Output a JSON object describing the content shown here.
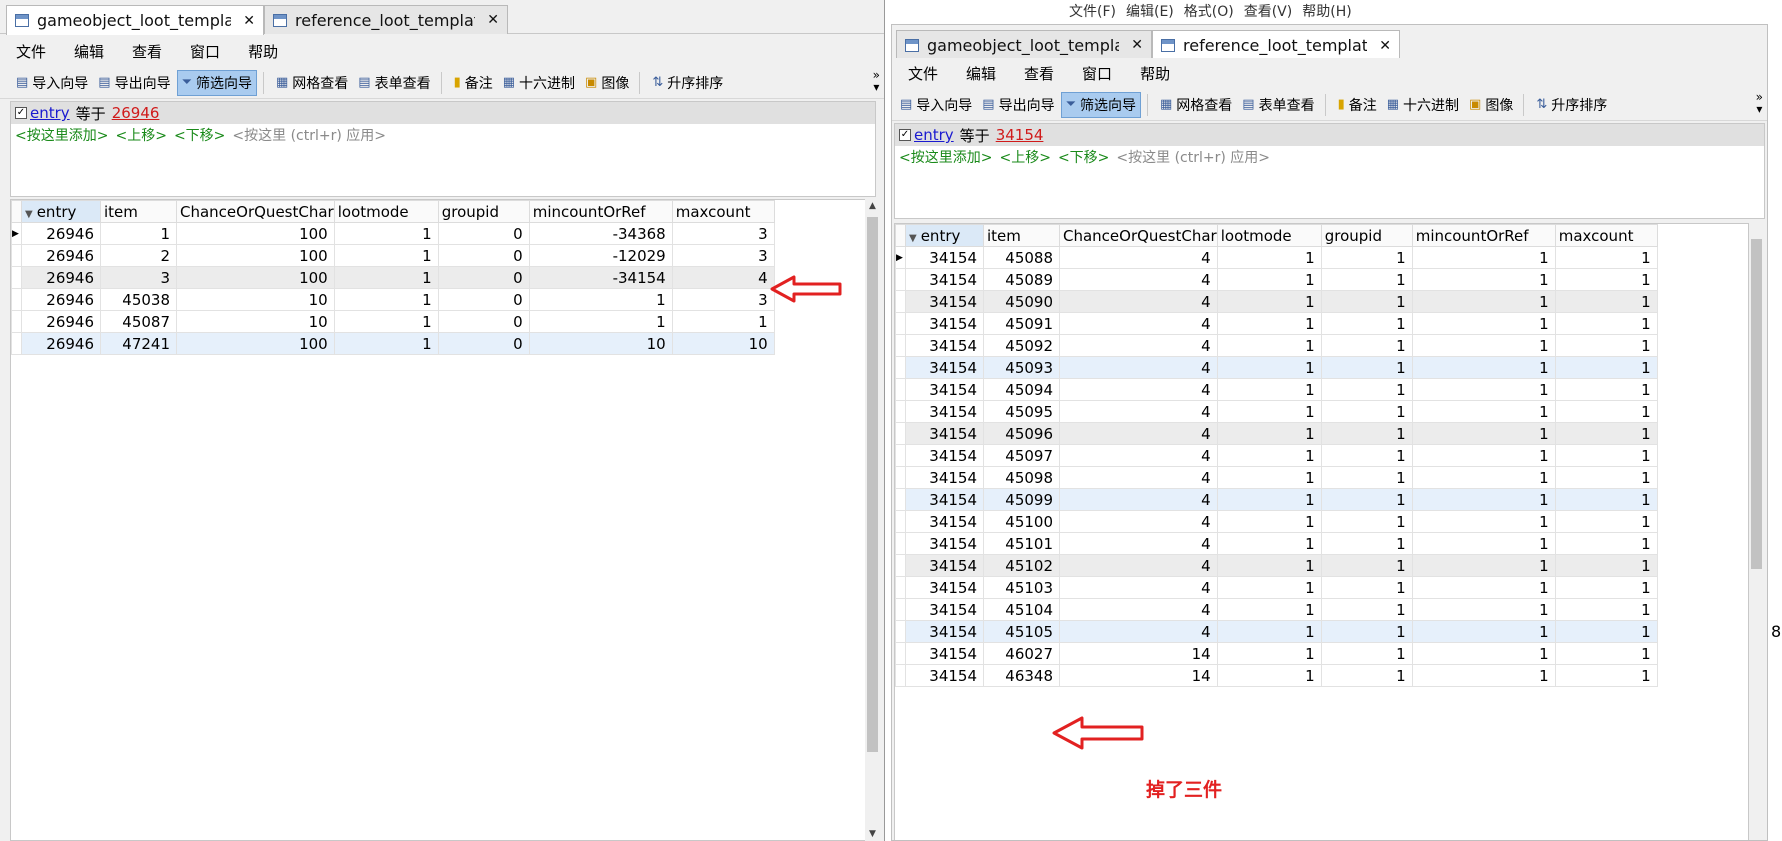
{
  "left": {
    "tabs": [
      {
        "label": "gameobject_loot_templa...",
        "active": true
      },
      {
        "label": "reference_loot_template...",
        "active": false
      }
    ],
    "menu": [
      "文件",
      "编辑",
      "查看",
      "窗口",
      "帮助"
    ],
    "toolbar": {
      "import": "导入向导",
      "export": "导出向导",
      "filter": "筛选向导",
      "grid_view": "网格查看",
      "form_view": "表单查看",
      "memo": "备注",
      "hex": "十六进制",
      "image": "图像",
      "sort_asc": "升序排序",
      "more": "»"
    },
    "filter": {
      "field": "entry",
      "op": "等于",
      "value": "26946",
      "add": "<按这里添加>",
      "up": "<上移>",
      "down": "<下移>",
      "apply": "<按这里 (ctrl+r) 应用>"
    },
    "columns": [
      "entry",
      "item",
      "ChanceOrQuestChar",
      "lootmode",
      "groupid",
      "mincountOrRef",
      "maxcount"
    ],
    "rows": [
      [
        "26946",
        "1",
        "100",
        "1",
        "0",
        "-34368",
        "3"
      ],
      [
        "26946",
        "2",
        "100",
        "1",
        "0",
        "-12029",
        "3"
      ],
      [
        "26946",
        "3",
        "100",
        "1",
        "0",
        "-34154",
        "4"
      ],
      [
        "26946",
        "45038",
        "10",
        "1",
        "0",
        "1",
        "3"
      ],
      [
        "26946",
        "45087",
        "10",
        "1",
        "0",
        "1",
        "1"
      ],
      [
        "26946",
        "47241",
        "100",
        "1",
        "0",
        "10",
        "10"
      ]
    ]
  },
  "right": {
    "background_menu": [
      "文件(F)",
      "编辑(E)",
      "格式(O)",
      "查看(V)",
      "帮助(H)"
    ],
    "tabs": [
      {
        "label": "gameobject_loot_templa...",
        "active": false
      },
      {
        "label": "reference_loot_template...",
        "active": true
      }
    ],
    "menu": [
      "文件",
      "编辑",
      "查看",
      "窗口",
      "帮助"
    ],
    "toolbar": {
      "import": "导入向导",
      "export": "导出向导",
      "filter": "筛选向导",
      "grid_view": "网格查看",
      "form_view": "表单查看",
      "memo": "备注",
      "hex": "十六进制",
      "image": "图像",
      "sort_asc": "升序排序",
      "more": "»"
    },
    "filter": {
      "field": "entry",
      "op": "等于",
      "value": "34154",
      "add": "<按这里添加>",
      "up": "<上移>",
      "down": "<下移>",
      "apply": "<按这里 (ctrl+r) 应用>"
    },
    "columns": [
      "entry",
      "item",
      "ChanceOrQuestChar",
      "lootmode",
      "groupid",
      "mincountOrRef",
      "maxcount"
    ],
    "rows": [
      [
        "34154",
        "45088",
        "4",
        "1",
        "1",
        "1",
        "1"
      ],
      [
        "34154",
        "45089",
        "4",
        "1",
        "1",
        "1",
        "1"
      ],
      [
        "34154",
        "45090",
        "4",
        "1",
        "1",
        "1",
        "1"
      ],
      [
        "34154",
        "45091",
        "4",
        "1",
        "1",
        "1",
        "1"
      ],
      [
        "34154",
        "45092",
        "4",
        "1",
        "1",
        "1",
        "1"
      ],
      [
        "34154",
        "45093",
        "4",
        "1",
        "1",
        "1",
        "1"
      ],
      [
        "34154",
        "45094",
        "4",
        "1",
        "1",
        "1",
        "1"
      ],
      [
        "34154",
        "45095",
        "4",
        "1",
        "1",
        "1",
        "1"
      ],
      [
        "34154",
        "45096",
        "4",
        "1",
        "1",
        "1",
        "1"
      ],
      [
        "34154",
        "45097",
        "4",
        "1",
        "1",
        "1",
        "1"
      ],
      [
        "34154",
        "45098",
        "4",
        "1",
        "1",
        "1",
        "1"
      ],
      [
        "34154",
        "45099",
        "4",
        "1",
        "1",
        "1",
        "1"
      ],
      [
        "34154",
        "45100",
        "4",
        "1",
        "1",
        "1",
        "1"
      ],
      [
        "34154",
        "45101",
        "4",
        "1",
        "1",
        "1",
        "1"
      ],
      [
        "34154",
        "45102",
        "4",
        "1",
        "1",
        "1",
        "1"
      ],
      [
        "34154",
        "45103",
        "4",
        "1",
        "1",
        "1",
        "1"
      ],
      [
        "34154",
        "45104",
        "4",
        "1",
        "1",
        "1",
        "1"
      ],
      [
        "34154",
        "45105",
        "4",
        "1",
        "1",
        "1",
        "1"
      ],
      [
        "34154",
        "46027",
        "14",
        "1",
        "1",
        "1",
        "1"
      ],
      [
        "34154",
        "46348",
        "14",
        "1",
        "1",
        "1",
        "1"
      ]
    ],
    "annotation": "掉了三件",
    "edge_digit": "8"
  },
  "colors": {
    "annotation": "#e22121",
    "filter_value": "#d01a1a",
    "filter_field": "#1a1ad0",
    "hint_green": "#1a8a1a"
  }
}
